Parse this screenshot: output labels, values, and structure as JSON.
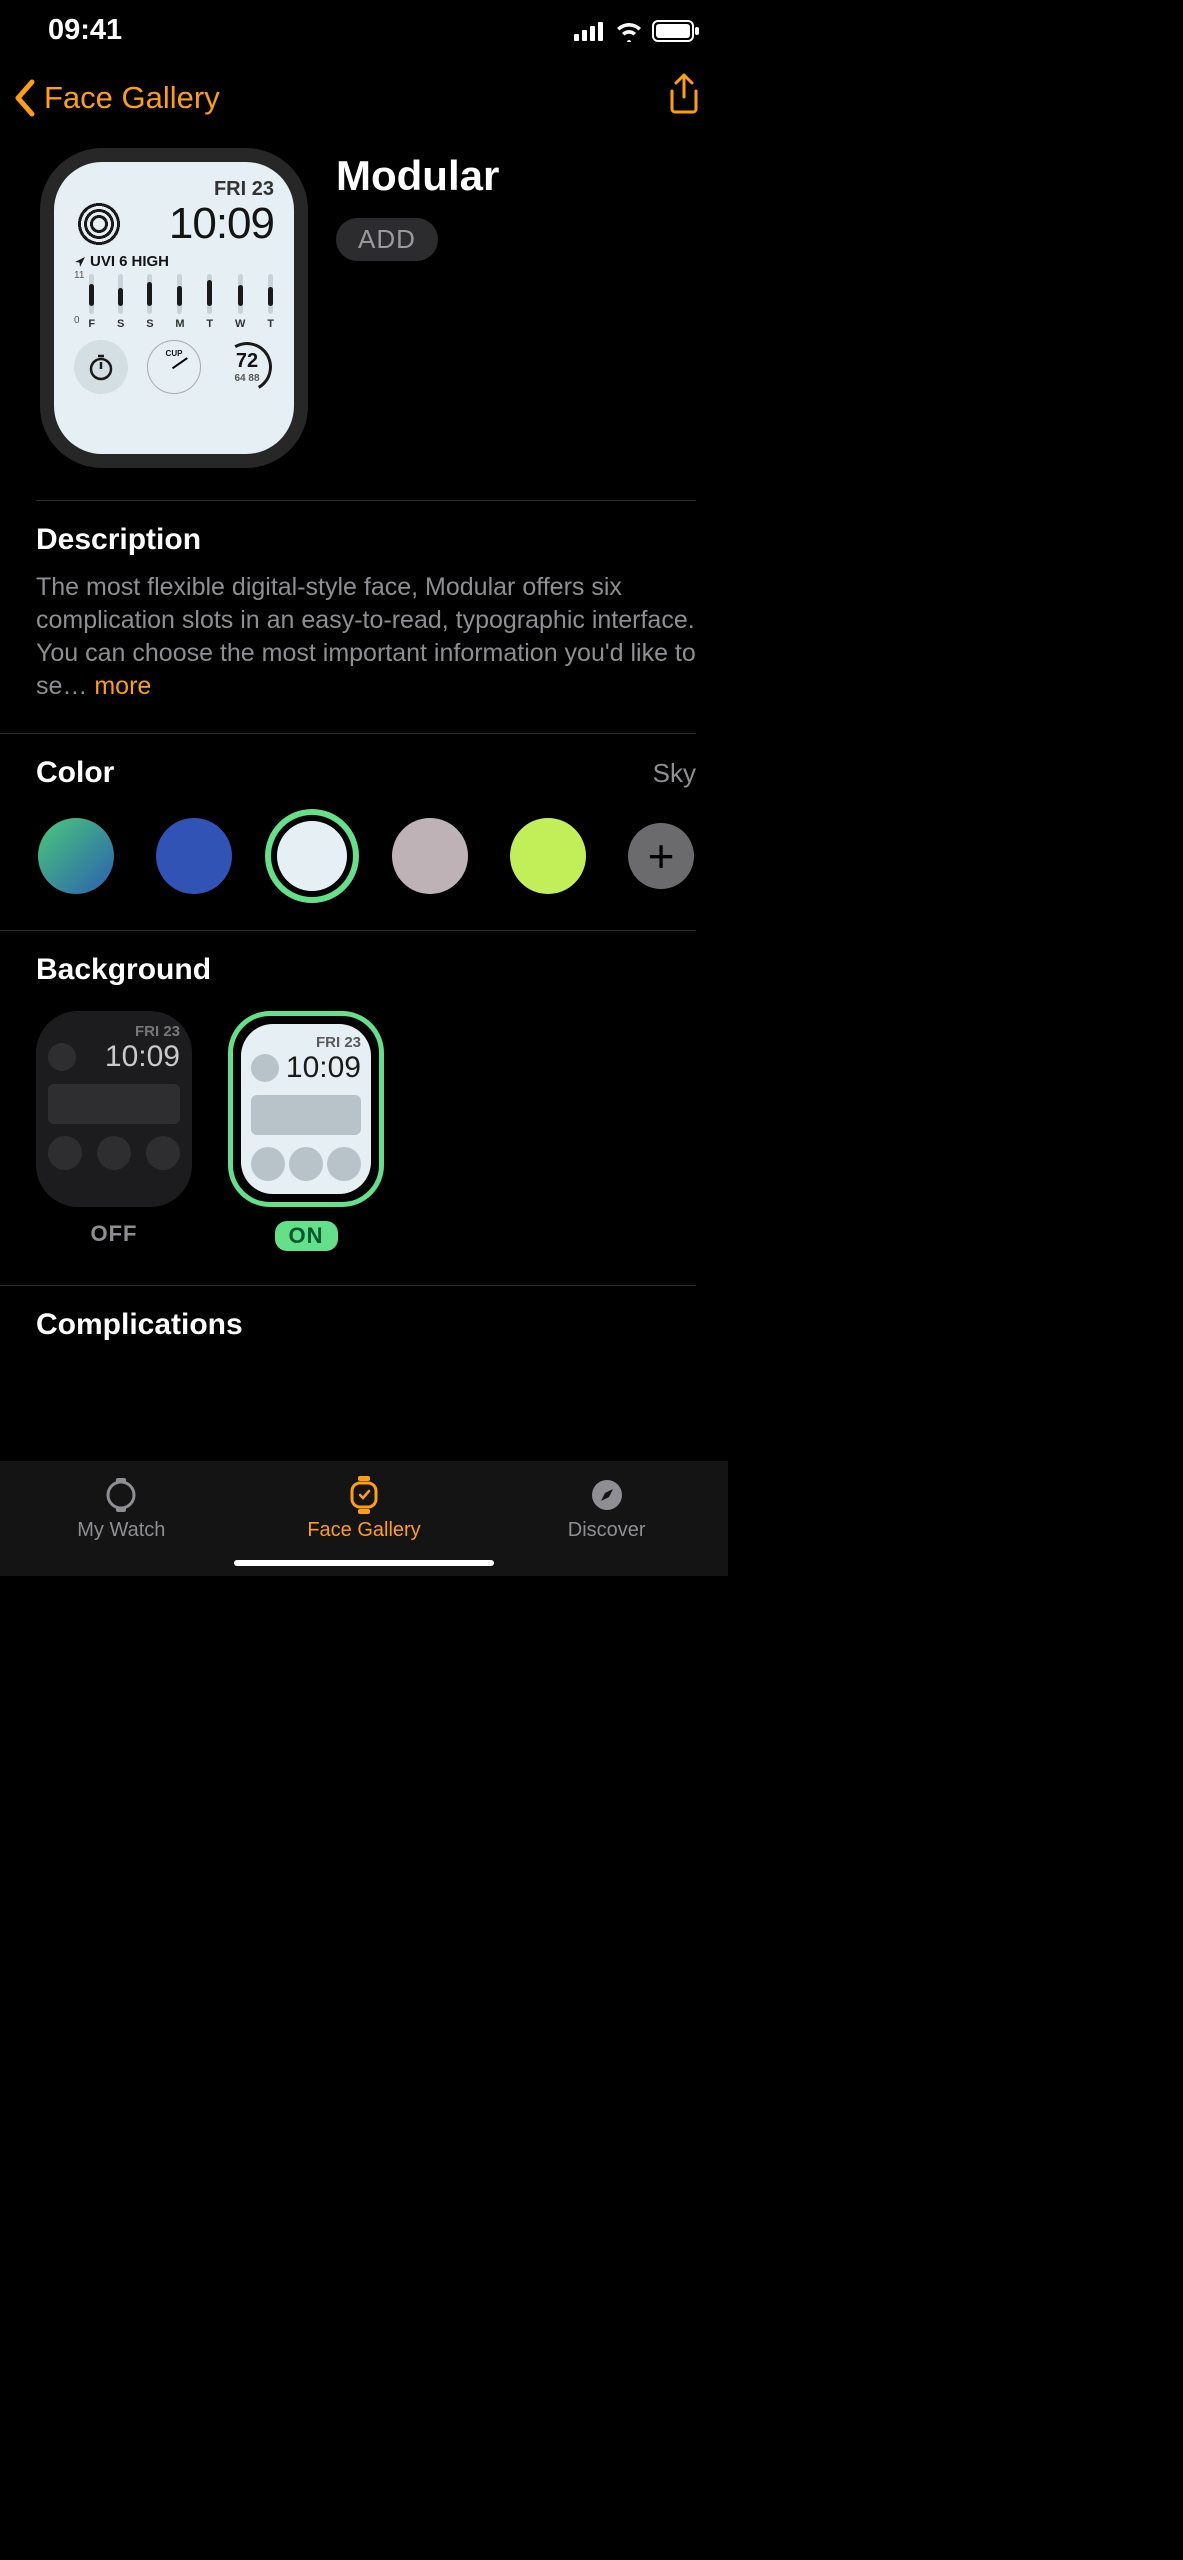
{
  "status": {
    "time": "09:41"
  },
  "nav": {
    "back_label": "Face Gallery"
  },
  "face": {
    "title": "Modular",
    "add_label": "ADD"
  },
  "preview": {
    "date": "FRI 23",
    "time": "10:09",
    "uv_prefix": "UVI 6",
    "uv_suffix": "HIGH",
    "scale_top": "11",
    "scale_bottom": "0",
    "days": [
      "F",
      "S",
      "S",
      "M",
      "T",
      "W",
      "T"
    ],
    "temp_main": "72",
    "temp_sub": "64  88"
  },
  "sections": {
    "description": {
      "title": "Description",
      "text": "The most flexible digital-style face, Modular offers six complication slots in an easy-to-read, typographic interface. You can choose the most important information you'd like to se…",
      "more": "more"
    },
    "color": {
      "title": "Color",
      "value": "Sky",
      "swatches": [
        {
          "name": "gradient-teal",
          "css": "linear-gradient(135deg,#4bc87a,#2a5fb0)"
        },
        {
          "name": "blue",
          "css": "#3053b5"
        },
        {
          "name": "sky",
          "css": "#e6f0f4",
          "selected": true
        },
        {
          "name": "mauve",
          "css": "#beb2b6"
        },
        {
          "name": "lime",
          "css": "#c2ee58"
        }
      ]
    },
    "background": {
      "title": "Background",
      "options": [
        {
          "label": "OFF",
          "date": "FRI 23",
          "time": "10:09",
          "selected": false
        },
        {
          "label": "ON",
          "date": "FRI 23",
          "time": "10:09",
          "selected": true
        }
      ]
    },
    "complications": {
      "title": "Complications"
    }
  },
  "tabs": {
    "my_watch": "My Watch",
    "face_gallery": "Face Gallery",
    "discover": "Discover"
  }
}
